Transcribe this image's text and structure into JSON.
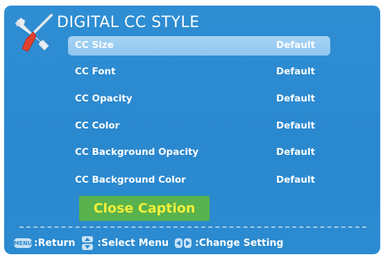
{
  "header": {
    "title": "DIGITAL CC STYLE",
    "icon": "tools-icon"
  },
  "menu": {
    "items": [
      {
        "label": "CC Size",
        "value": "Default",
        "selected": true
      },
      {
        "label": "CC Font",
        "value": "Default"
      },
      {
        "label": "CC Opacity",
        "value": "Default"
      },
      {
        "label": "CC Color",
        "value": "Default"
      },
      {
        "label": "CC Background Opacity",
        "value": "Default"
      },
      {
        "label": "CC Background Color",
        "value": "Default"
      }
    ]
  },
  "close_caption": {
    "label": "Close Caption",
    "bg_color": "#58b24d",
    "text_color": "#f3f03a"
  },
  "footer": {
    "return_key": "MENU",
    "return_label": ":Return",
    "select_label": ":Select Menu",
    "change_label": ":Change Setting"
  },
  "colors": {
    "background": "#2a88cf",
    "highlight": "#9dd0f2"
  }
}
